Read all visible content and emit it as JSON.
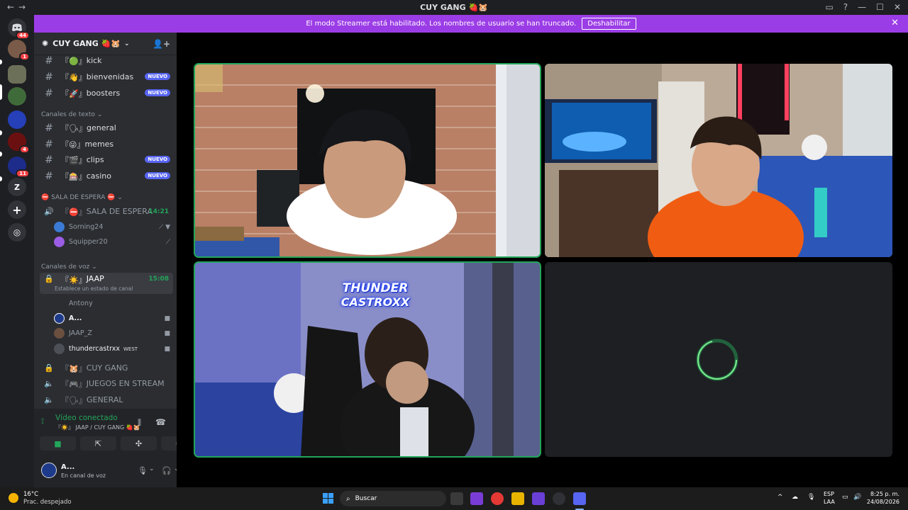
{
  "window": {
    "title": "CUY GANG 🍓🐹"
  },
  "banner": {
    "text": "El modo Streamer está habilitado. Los nombres de usuario se han truncado.",
    "button": "Deshabilitar"
  },
  "servers": {
    "home_badge": "44",
    "badges": [
      "1",
      "4",
      "11"
    ],
    "z_label": "Z"
  },
  "guild": {
    "name": "CUY GANG 🍓🐹"
  },
  "channels": [
    {
      "prefix": "『🟢』",
      "name": "kick",
      "badge": ""
    },
    {
      "prefix": "『👋』",
      "name": "bienvenidas",
      "badge": "NUEVO"
    },
    {
      "prefix": "『🚀』",
      "name": "boosters",
      "badge": "NUEVO"
    }
  ],
  "category_text": "Canales de texto",
  "text_channels": [
    {
      "prefix": "『🗣』",
      "name": "general",
      "badge": ""
    },
    {
      "prefix": "『😜』",
      "name": "memes",
      "badge": ""
    },
    {
      "prefix": "『🎬』",
      "name": "clips",
      "badge": "NUEVO"
    },
    {
      "prefix": "『🎰』",
      "name": "casino",
      "badge": "NUEVO"
    }
  ],
  "category_wait": "⛔ SALA DE ESPERA ⛔",
  "wait_channel": {
    "prefix": "『⛔』",
    "name": "SALA DE ESPERA",
    "timer": "14:21"
  },
  "wait_users": [
    "Sorning24",
    "Squipper20"
  ],
  "category_voice": "Canales de voz",
  "voice_main": {
    "prefix": "『☀️』",
    "name": "JAAP",
    "timer": "15:08",
    "status": "Establece un estado de canal"
  },
  "voice_users": [
    {
      "name": "Antony",
      "tag": ""
    },
    {
      "name": "A...",
      "tag": ""
    },
    {
      "name": "JAAP_Z",
      "tag": ""
    },
    {
      "name": "thundercastrxx",
      "tag": "WEST"
    }
  ],
  "voice_channels": [
    {
      "prefix": "『🐹』",
      "name": "CUY GANG"
    },
    {
      "prefix": "『🎮』",
      "name": "JUEGOS EN STREAM"
    },
    {
      "prefix": "『🗣』",
      "name": "GENERAL"
    }
  ],
  "panel": {
    "status": "Vídeo conectado",
    "location": "『☀️』 JAAP / CUY GANG 🍓🐹",
    "user": "A...",
    "user_status": "En canal de voz"
  },
  "tiles": {
    "thunder_line1": "THUNDER",
    "thunder_line2": "CASTROXX"
  },
  "taskbar": {
    "weather_temp": "16°C",
    "weather_desc": "Prac. despejado",
    "search": "Buscar",
    "lang1": "ESP",
    "lang2": "LAA",
    "time": "8:25 p. m.",
    "date": "24/08/2026"
  },
  "colors": {
    "accent": "#9b3de6",
    "speaking": "#23a55a",
    "blurple": "#5865f2"
  }
}
